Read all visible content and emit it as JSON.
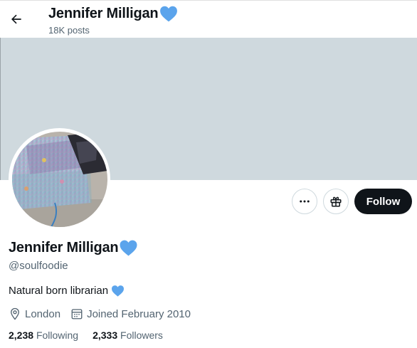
{
  "header": {
    "name": "Jennifer Milligan",
    "posts": "18K posts"
  },
  "profile": {
    "name": "Jennifer Milligan",
    "handle": "@soulfoodie",
    "bio": "Natural born librarian",
    "location": "London",
    "joined": "Joined February 2010"
  },
  "actions": {
    "follow_label": "Follow"
  },
  "stats": {
    "following_count": "2,238",
    "following_label": "Following",
    "followers_count": "2,333",
    "followers_label": "Followers"
  },
  "colors": {
    "heart": "#5ba4ec",
    "banner": "#cfd9de",
    "follow_bg": "#0f1419",
    "muted_text": "#536471"
  },
  "icons": {
    "back": "arrow-left-icon",
    "heart": "blue-heart-icon",
    "more": "more-icon",
    "gift": "gift-icon",
    "location": "location-pin-icon",
    "calendar": "calendar-icon"
  }
}
